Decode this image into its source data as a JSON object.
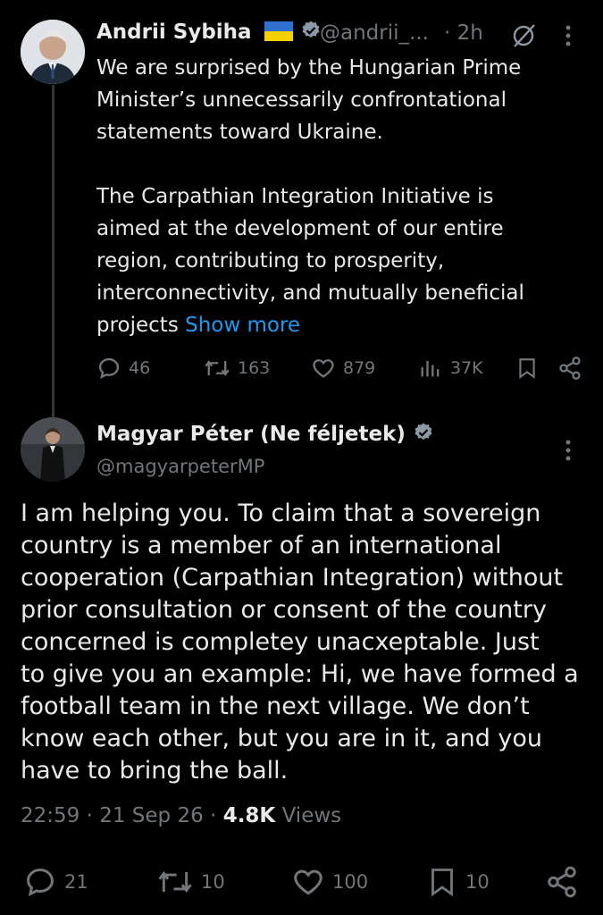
{
  "tweet1": {
    "name": "Andrii Sybiha",
    "handle": "@andrii_...",
    "time": "· 2h",
    "line1": "We are surprised by the Hungarian Prime",
    "line2": "Minister’s unnecessarily confrontational",
    "line3": "statements toward Ukraine.",
    "line4": "The Carpathian Integration Initiative is",
    "line5": "aimed at the development of our entire",
    "line6": "region, contributing to prosperity,",
    "line7": "interconnectivity, and mutually beneficial",
    "line8": "projects",
    "show_more": "Show more",
    "replies": "46",
    "reposts": "163",
    "likes": "879",
    "views": "37K"
  },
  "tweet2": {
    "name": "Magyar Péter (Ne féljetek)",
    "handle": "@magyarpeterMP",
    "lines": [
      "I am helping you. To claim that a sovereign",
      "country is a member of an international",
      "cooperation (Carpathian Integration) without",
      "prior consultation or consent of the country",
      "concerned is completey unacxeptable. Just",
      "to give you an example: Hi, we have formed a",
      "football team in the next village. We don’t",
      "know each other, but you are in it, and you",
      "have to bring the ball."
    ],
    "timestamp": "22:59",
    "date": "21 Sep 26",
    "views_count": "4.8K",
    "views_label": "Views",
    "replies": "21",
    "reposts": "10",
    "likes": "100",
    "bookmarks": "10"
  },
  "colors": {
    "background": "#000000",
    "text": "#e7e9ea",
    "muted": "#71767b",
    "link": "#1d9bf0",
    "verified": "#8b98a5"
  }
}
